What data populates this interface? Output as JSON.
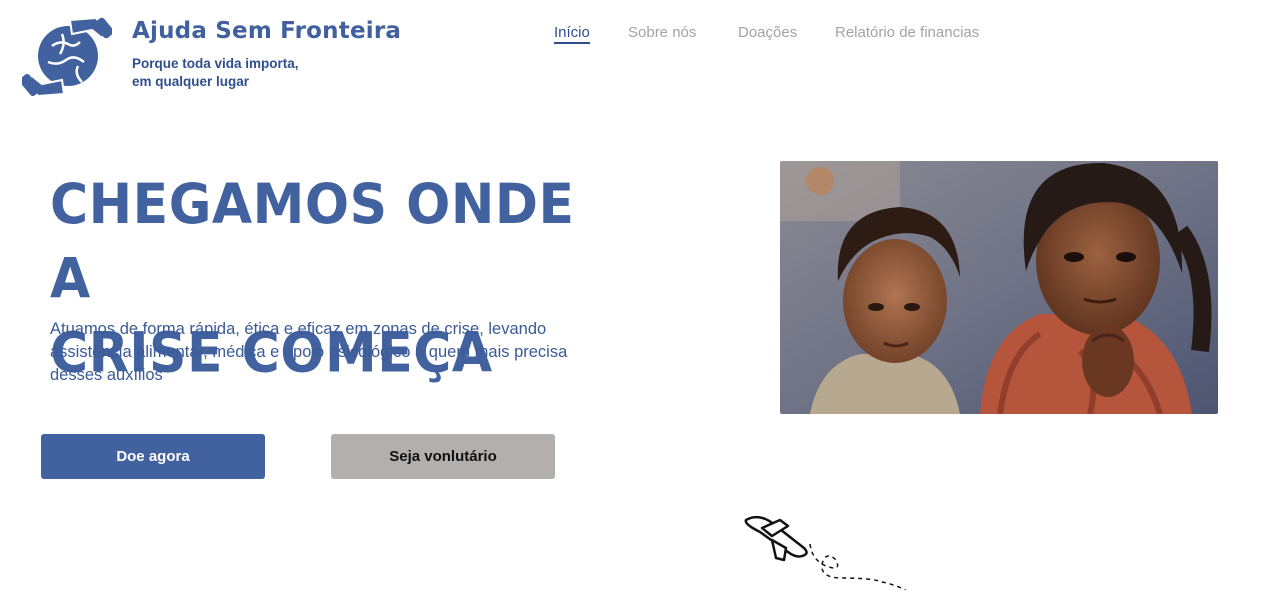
{
  "brand": {
    "name": "Ajuda Sem Fronteira",
    "tagline_line1": "Porque toda vida importa,",
    "tagline_line2": "em qualquer lugar"
  },
  "nav": {
    "items": [
      {
        "label": "Início",
        "active": true
      },
      {
        "label": "Sobre nós",
        "active": false
      },
      {
        "label": "Doações",
        "active": false
      },
      {
        "label": "Relatório de financias",
        "active": false
      }
    ]
  },
  "hero": {
    "title_line1": "CHEGAMOS ONDE A",
    "title_line2": "CRISE COMEÇA",
    "description": "Atuamos de forma rápida, ética e eficaz em zonas de crise, levando assistência alimentar, médica e apoio psicológico a quem mais precisa desses auxílios",
    "donate_label": "Doe agora",
    "volunteer_label": "Seja vonlutário"
  },
  "icons": {
    "logo": "hands-globe-icon",
    "decoration": "airplane-icon"
  },
  "colors": {
    "brand": "#42629f",
    "nav_inactive": "#a3a3a3",
    "button_secondary": "#b3afae"
  }
}
